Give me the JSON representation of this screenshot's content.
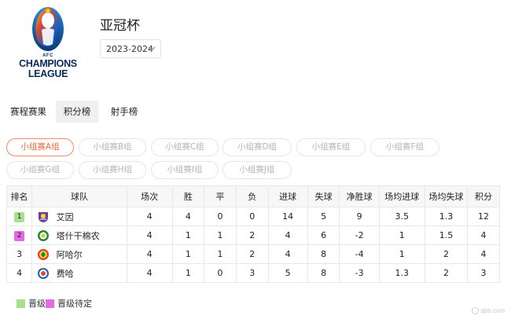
{
  "header": {
    "logo": {
      "line1": "AFC",
      "line2": "CHAMPIONS",
      "line3": "LEAGUE"
    },
    "title": "亚冠杯",
    "season": "2023-2024"
  },
  "tabs": [
    "赛程赛果",
    "积分榜",
    "射手榜"
  ],
  "active_tab": "积分榜",
  "groups": [
    "小组赛A组",
    "小组赛B组",
    "小组赛C组",
    "小组赛D组",
    "小组赛E组",
    "小组赛F组",
    "小组赛G组",
    "小组赛H组",
    "小组赛I组",
    "小组赛J组"
  ],
  "active_group": "小组赛A组",
  "table": {
    "headers": [
      "排名",
      "球队",
      "场次",
      "胜",
      "平",
      "负",
      "进球",
      "失球",
      "净胜球",
      "场均进球",
      "场均失球",
      "积分"
    ],
    "rows": [
      {
        "rank": "1",
        "team": "艾因",
        "played": "4",
        "won": "4",
        "drawn": "0",
        "lost": "0",
        "gf": "14",
        "ga": "5",
        "gd": "9",
        "avg_gf": "3.5",
        "avg_ga": "1.3",
        "pts": "12",
        "status": "qualified",
        "crest_icon": "al-ain-crest-icon"
      },
      {
        "rank": "2",
        "team": "塔什干棉农",
        "played": "4",
        "won": "1",
        "drawn": "1",
        "lost": "2",
        "gf": "4",
        "ga": "6",
        "gd": "-2",
        "avg_gf": "1",
        "avg_ga": "1.5",
        "pts": "4",
        "status": "pending",
        "crest_icon": "pakhtakor-crest-icon"
      },
      {
        "rank": "3",
        "team": "阿哈尔",
        "played": "4",
        "won": "1",
        "drawn": "1",
        "lost": "2",
        "gf": "4",
        "ga": "8",
        "gd": "-4",
        "avg_gf": "1",
        "avg_ga": "2",
        "pts": "4",
        "status": "",
        "crest_icon": "ahal-crest-icon"
      },
      {
        "rank": "4",
        "team": "费哈",
        "played": "4",
        "won": "1",
        "drawn": "0",
        "lost": "3",
        "gf": "5",
        "ga": "8",
        "gd": "-3",
        "avg_gf": "1.3",
        "avg_ga": "2",
        "pts": "3",
        "status": "",
        "crest_icon": "al-feiha-crest-icon"
      }
    ]
  },
  "legend": {
    "qualified": "晋级",
    "pending": "晋级待定"
  },
  "colors": {
    "qualified": "#a8e08e",
    "pending": "#e66ae6",
    "accent": "#ec6a43"
  },
  "watermark": "qbb.com"
}
